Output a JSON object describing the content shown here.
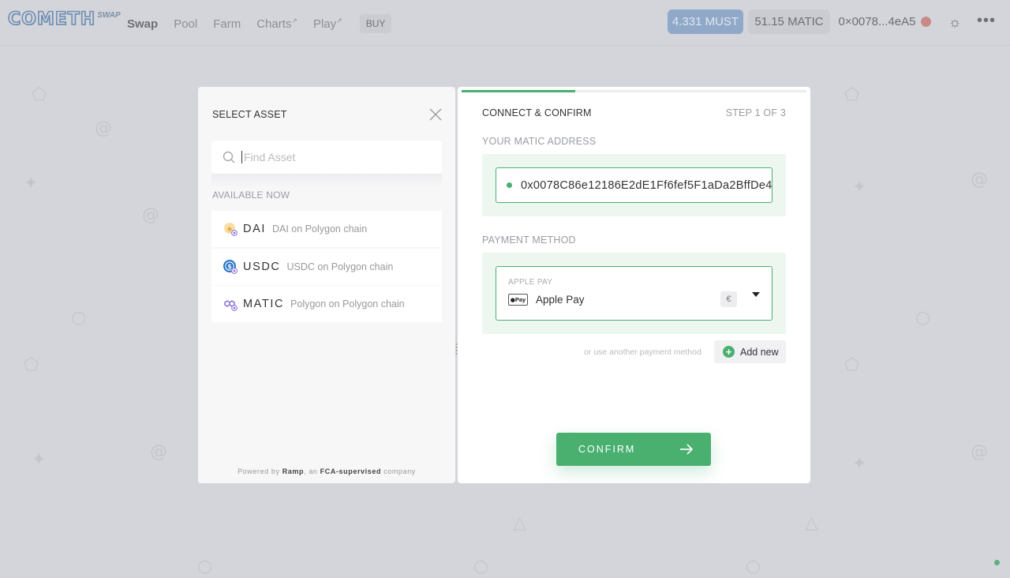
{
  "nav": {
    "logo_main": "COMETH",
    "logo_sub": "SWAP",
    "items": [
      {
        "label": "Swap",
        "external": ""
      },
      {
        "label": "Pool",
        "external": ""
      },
      {
        "label": "Farm",
        "external": ""
      },
      {
        "label": "Charts",
        "external": "↗"
      },
      {
        "label": "Play",
        "external": "↗"
      }
    ],
    "buy_label": "BUY",
    "must_balance": "4.331 MUST",
    "matic_balance": "51.15 MATIC",
    "wallet_address": "0×0078...4eA5"
  },
  "select_asset": {
    "title": "SELECT ASSET",
    "search_placeholder": "Find Asset",
    "available_label": "AVAILABLE NOW",
    "assets": [
      {
        "symbol": "DAI",
        "description": "DAI on Polygon chain",
        "icon": "dai-icon"
      },
      {
        "symbol": "USDC",
        "description": "USDC on Polygon chain",
        "icon": "usdc-icon"
      },
      {
        "symbol": "MATIC",
        "description": "Polygon on Polygon chain",
        "icon": "matic-icon"
      }
    ],
    "powered_prefix": "Powered by",
    "powered_ramp": "Ramp",
    "powered_mid": ", an",
    "powered_fca": "FCA-supervised",
    "powered_suffix": "company"
  },
  "confirm": {
    "title": "CONNECT & CONFIRM",
    "step": "STEP 1 OF 3",
    "progress": 0.33,
    "address_label": "YOUR MATIC ADDRESS",
    "address_value": "0x0078C86e12186E2dE1Ff6fef5F1aDa2BffDe4",
    "payment_label": "PAYMENT METHOD",
    "payment_small": "APPLE PAY",
    "payment_badge": "Pay",
    "payment_name": "Apple Pay",
    "currency": "€",
    "alt_method": "or use another payment method",
    "add_new": "Add new",
    "confirm_label": "CONFIRM"
  },
  "colors": {
    "accent_green": "#49b070",
    "overlay": "#d4d5da",
    "must_badge": "#90a9c8"
  }
}
